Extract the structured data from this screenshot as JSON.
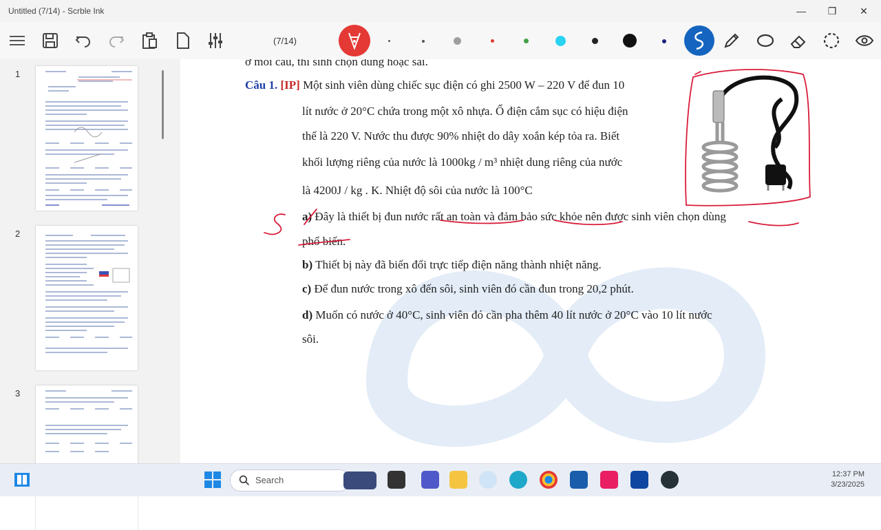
{
  "window": {
    "title": "Untitled (7/14) - Scrble Ink"
  },
  "toolbar": {
    "page_indicator": "(7/14)",
    "colors": {
      "active_pen": "#e53935",
      "red": "#e53935",
      "green": "#43a047",
      "cyan": "#29d3f0",
      "dark": "#222222",
      "navy": "#1a237e",
      "gray": "#9e9e9e",
      "blue_tool": "#1565c0"
    }
  },
  "sidebar": {
    "pages": [
      {
        "number": "1"
      },
      {
        "number": "2"
      },
      {
        "number": "3"
      }
    ]
  },
  "document": {
    "line0": "ở mỗi câu, thí sinh chọn đúng hoặc sai.",
    "cau_label": "Câu 1.",
    "cau_tag": "[IP]",
    "line1": "Một sinh viên dùng chiếc sục điện có ghi 2500 W – 220 V để đun 10",
    "line2": "lít nước ở 20°C chứa trong một xô nhựa. Ổ điện cắm sục có hiệu điện",
    "line3": "thế là 220 V. Nước thu được 90% nhiệt do dây xoắn kép tỏa ra. Biết",
    "line4": "khối lượng riêng của nước là 1000kg / m³ nhiệt dung riêng của nước",
    "line5": "là 4200J / kg . K. Nhiệt độ sôi của nước là 100°C",
    "a_label": "a)",
    "a_text": "Đây là thiết bị đun nước rất an toàn và đảm bảo sức khỏe nên được sinh viên chọn dùng",
    "a_text2": "phổ biến.",
    "b_label": "b)",
    "b_text": "Thiết bị này đã biến đổi trực tiếp điện năng thành nhiệt năng.",
    "c_label": "c)",
    "c_text": "Để đun nước trong xô đến sôi, sinh viên đó cần đun trong 20,2 phút.",
    "d_label": "d)",
    "d_text": "Muốn có nước ở 40°C, sinh viên đó cần pha thêm 40 lít nước ở 20°C vào 10 lít nước",
    "d_text2": "sôi.",
    "annotation_mark": "S"
  },
  "taskbar": {
    "search_placeholder": "Search",
    "time": "12:37 PM",
    "date": "3/23/2025"
  }
}
